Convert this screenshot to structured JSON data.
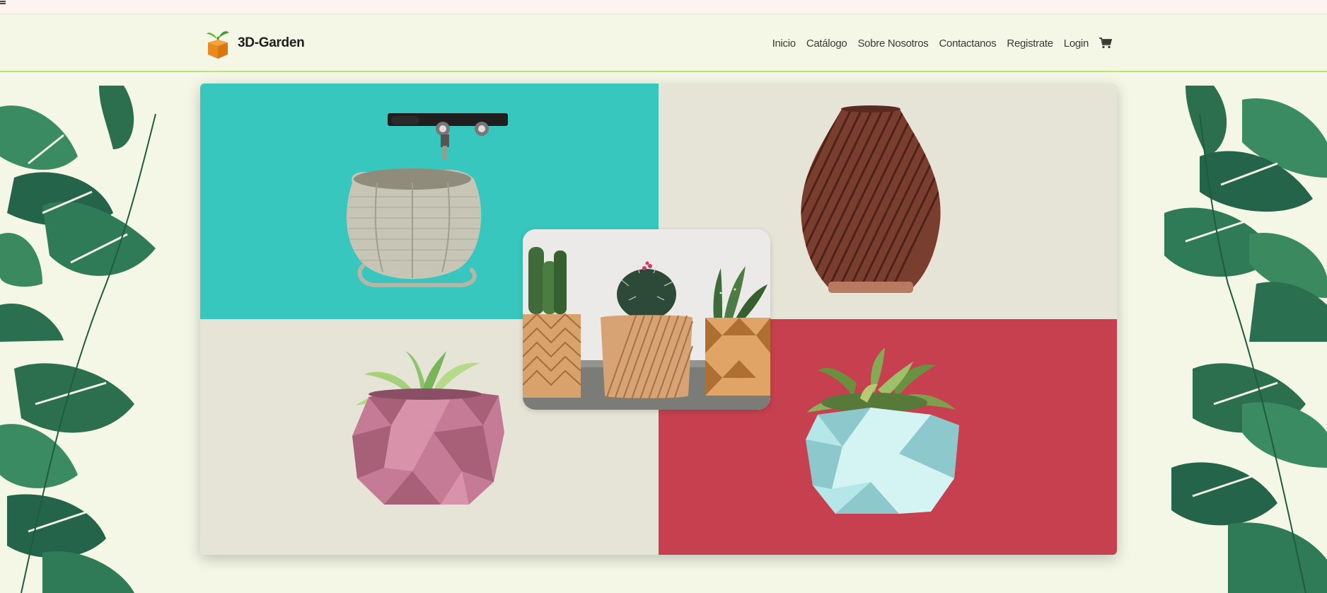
{
  "brand": {
    "name": "3D-Garden",
    "logo_icon": "sprout-box-icon"
  },
  "nav": {
    "links": [
      {
        "label": "Inicio"
      },
      {
        "label": "Catálogo"
      },
      {
        "label": "Sobre Nosotros"
      },
      {
        "label": "Contactanos"
      },
      {
        "label": "Registrate"
      },
      {
        "label": "Login"
      }
    ],
    "cart_icon": "shopping-cart-icon"
  },
  "hero": {
    "panels": [
      {
        "name": "printer-pot-panel",
        "color": "#37c7be"
      },
      {
        "name": "spiral-vase-panel",
        "color": "#e6e4d6"
      },
      {
        "name": "pink-pot-panel",
        "color": "#e6e4d6"
      },
      {
        "name": "blue-pot-panel",
        "color": "#c6404f"
      }
    ]
  },
  "colors": {
    "page_bg": "#f4f7e6",
    "nav_border": "#bde07a",
    "leaf": "#2f7a57"
  }
}
